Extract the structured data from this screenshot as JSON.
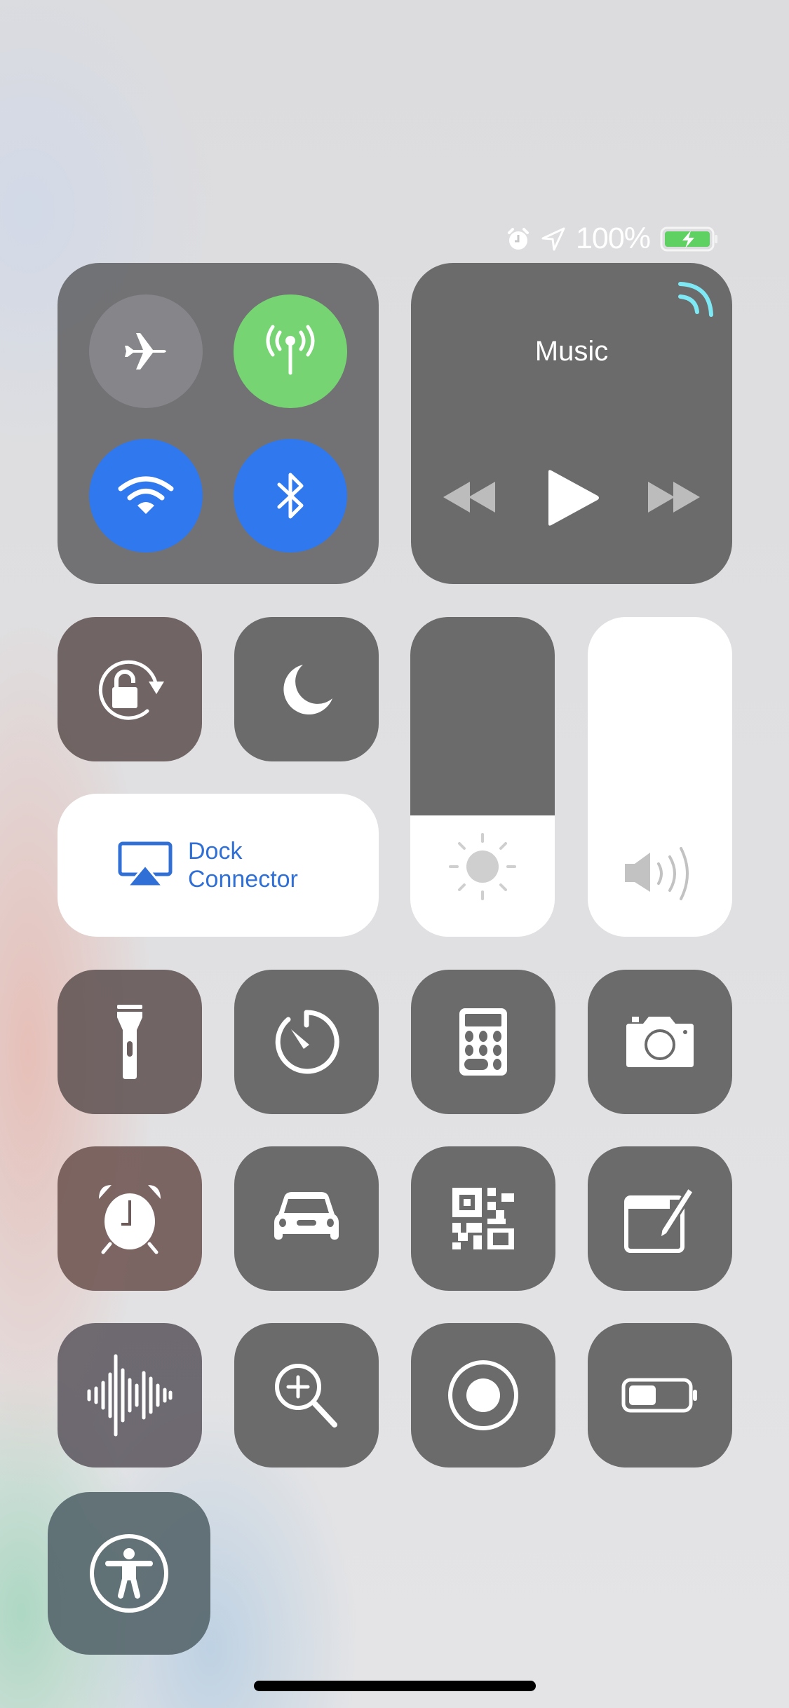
{
  "status_bar": {
    "icons": [
      "alarm-icon",
      "location-arrow-icon"
    ],
    "battery_percent_label": "100%",
    "battery_level": 1.0,
    "charging": true,
    "battery_color": "#4cd964"
  },
  "connectivity": {
    "airplane_mode": {
      "icon": "airplane-icon",
      "state": "off"
    },
    "cellular_data": {
      "icon": "antenna-icon",
      "state": "on",
      "color": "#76d572"
    },
    "wifi": {
      "icon": "wifi-icon",
      "state": "on",
      "color": "#2f78ee"
    },
    "bluetooth": {
      "icon": "bluetooth-icon",
      "state": "on",
      "color": "#2f78ee"
    }
  },
  "music": {
    "title": "Music",
    "airplay_audio_icon": "airplay-audio-icon",
    "airplay_audio_color": "#7ee9f5",
    "controls": [
      "previous-track-icon",
      "play-icon",
      "next-track-icon"
    ]
  },
  "toggles_row": [
    {
      "name": "orientation-lock",
      "icon": "rotation-lock-icon"
    },
    {
      "name": "do-not-disturb",
      "icon": "moon-icon"
    }
  ],
  "screen_mirroring": {
    "icon": "airplay-video-icon",
    "label_line1": "Dock",
    "label_line2": "Connector",
    "color": "#2f6fd6"
  },
  "brightness": {
    "icon": "sun-icon",
    "level": 0.38
  },
  "volume": {
    "icon": "speaker-icon",
    "level": 1.0
  },
  "utilities": [
    {
      "name": "flashlight",
      "icon": "flashlight-icon"
    },
    {
      "name": "timer",
      "icon": "timer-icon"
    },
    {
      "name": "calculator",
      "icon": "calculator-icon"
    },
    {
      "name": "camera",
      "icon": "camera-icon"
    },
    {
      "name": "alarm",
      "icon": "alarm-clock-icon"
    },
    {
      "name": "apple-tv-remote-car",
      "icon": "car-icon"
    },
    {
      "name": "qr-code-scanner",
      "icon": "qr-code-icon"
    },
    {
      "name": "notes",
      "icon": "notes-icon"
    },
    {
      "name": "voice-memos",
      "icon": "waveform-icon"
    },
    {
      "name": "magnifier",
      "icon": "magnifier-icon"
    },
    {
      "name": "screen-recording",
      "icon": "record-icon"
    },
    {
      "name": "low-power-mode",
      "icon": "battery-low-icon"
    },
    {
      "name": "accessibility-shortcut",
      "icon": "accessibility-icon"
    }
  ]
}
